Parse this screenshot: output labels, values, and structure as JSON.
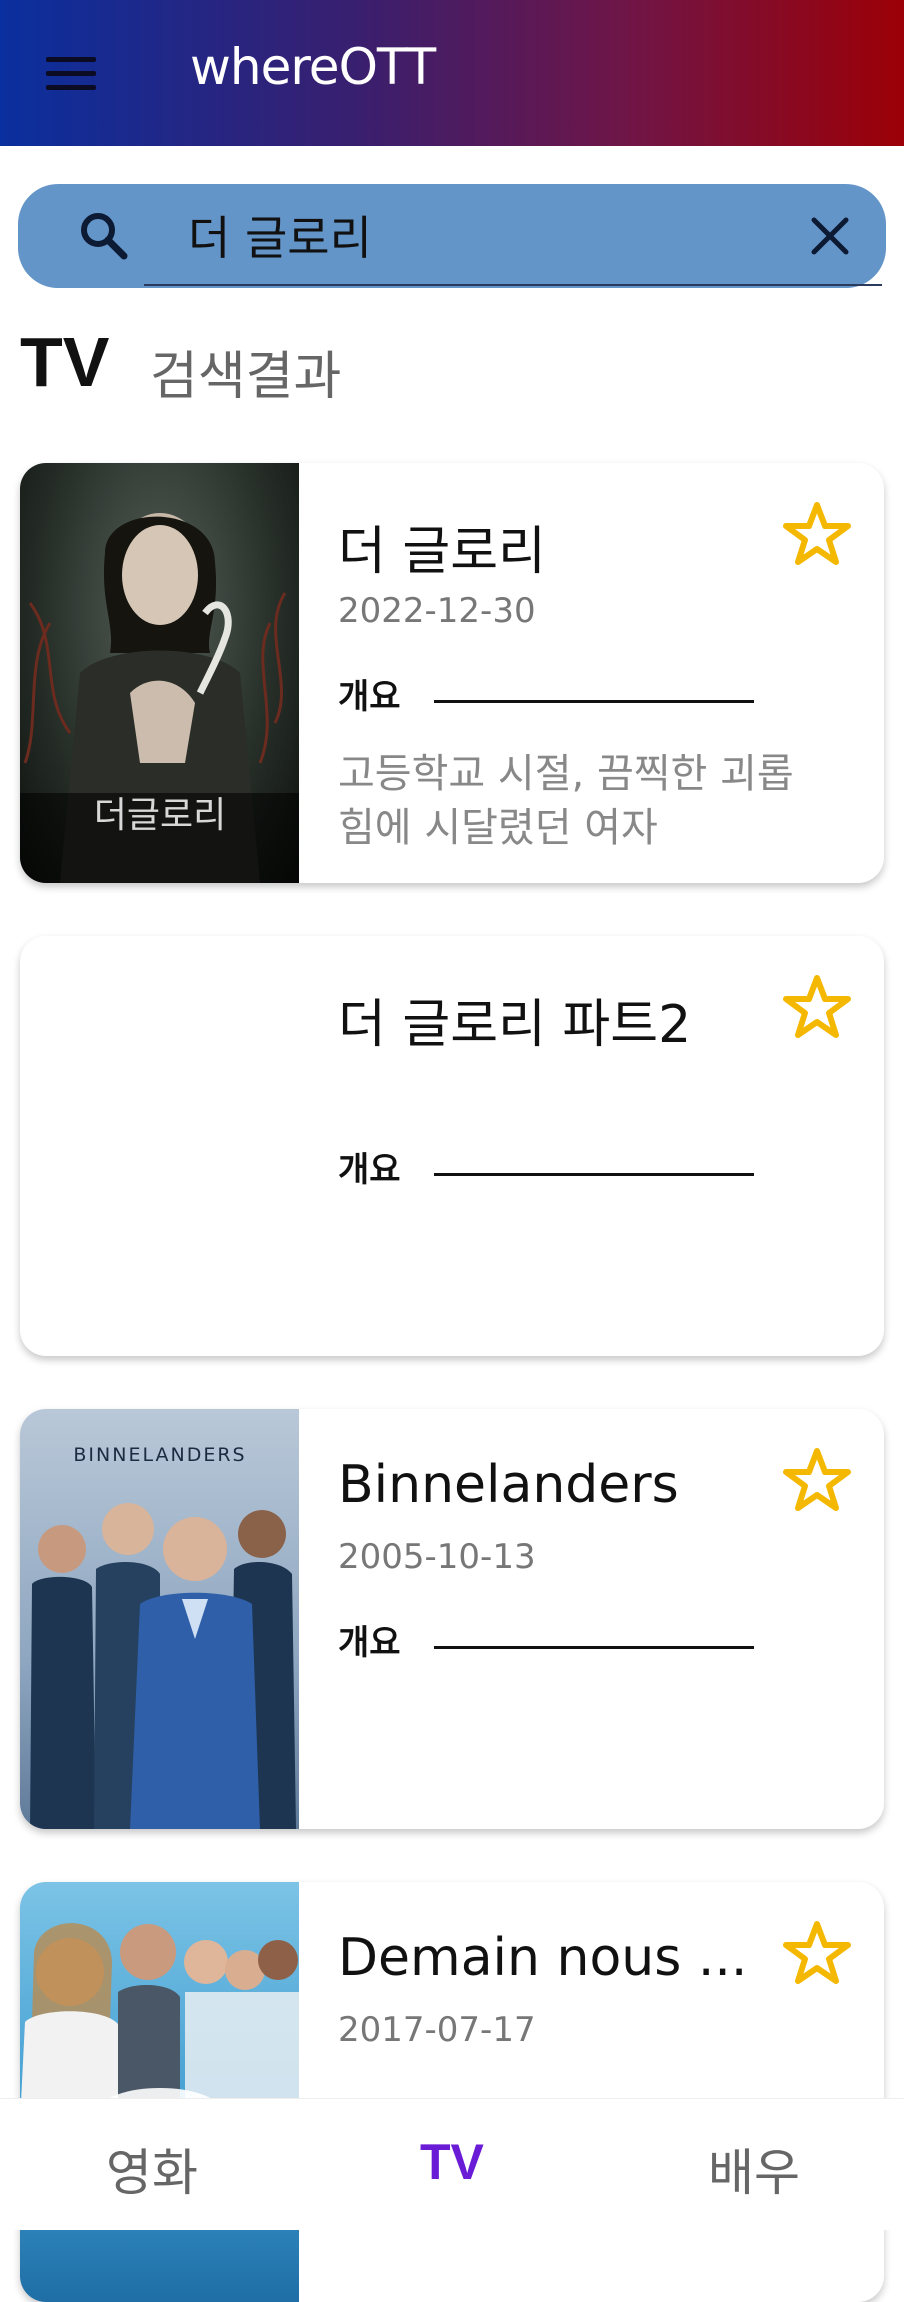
{
  "app": {
    "title": "whereOTT"
  },
  "search": {
    "query": "더 글로리"
  },
  "section": {
    "title": "TV",
    "subtitle": "검색결과"
  },
  "results": [
    {
      "title": "더 글로리",
      "date": "2022-12-30",
      "overview_label": "개요",
      "overview": "고등학교 시절, 끔찍한 괴롭힘에 시달렸던 여자",
      "poster_text": "더글로리",
      "has_poster": true
    },
    {
      "title": "더 글로리 파트2",
      "date": "",
      "overview_label": "개요",
      "overview": "",
      "has_poster": false
    },
    {
      "title": "Binnelanders",
      "date": "2005-10-13",
      "overview_label": "개요",
      "overview": "",
      "poster_text": "BINNELANDERS",
      "has_poster": true
    },
    {
      "title": "Demain nous ...",
      "date": "2017-07-17",
      "overview_label": "개요",
      "overview": "",
      "has_poster": true
    }
  ],
  "bottom_nav": {
    "items": [
      {
        "label": "영화"
      },
      {
        "label": "TV"
      },
      {
        "label": "배우"
      }
    ],
    "active_index": 1
  },
  "colors": {
    "accent": "#6a1bd6",
    "search_bg": "#6495c9",
    "star": "#f5b800",
    "header_start": "#0a2f9e",
    "header_end": "#9c0006"
  },
  "icons": {
    "menu": "menu-icon",
    "search": "search-icon",
    "clear": "close-icon",
    "favorite": "star-outline-icon"
  }
}
